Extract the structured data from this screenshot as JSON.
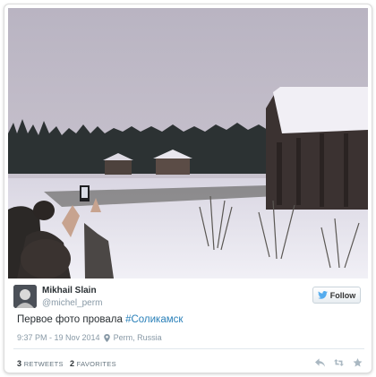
{
  "tweet": {
    "author_name": "Mikhail Slain",
    "author_handle": "@michel_perm",
    "follow_label": "Follow",
    "text_plain": "Первое фото провала ",
    "hashtag": "#Соликамск",
    "timestamp": "9:37 PM - 19 Nov 2014",
    "location": "Perm, Russia",
    "retweets_count": "3",
    "retweets_label": "RETWEETS",
    "favorites_count": "2",
    "favorites_label": "FAVORITES"
  },
  "icons": {
    "bird": "twitter-bird-icon",
    "pin": "location-pin-icon",
    "reply": "reply-icon",
    "retweet": "retweet-icon",
    "favorite": "star-icon"
  },
  "colors": {
    "hashtag": "#2a80b9",
    "follow_bird": "#55acee",
    "meta_text": "#8899a6"
  }
}
